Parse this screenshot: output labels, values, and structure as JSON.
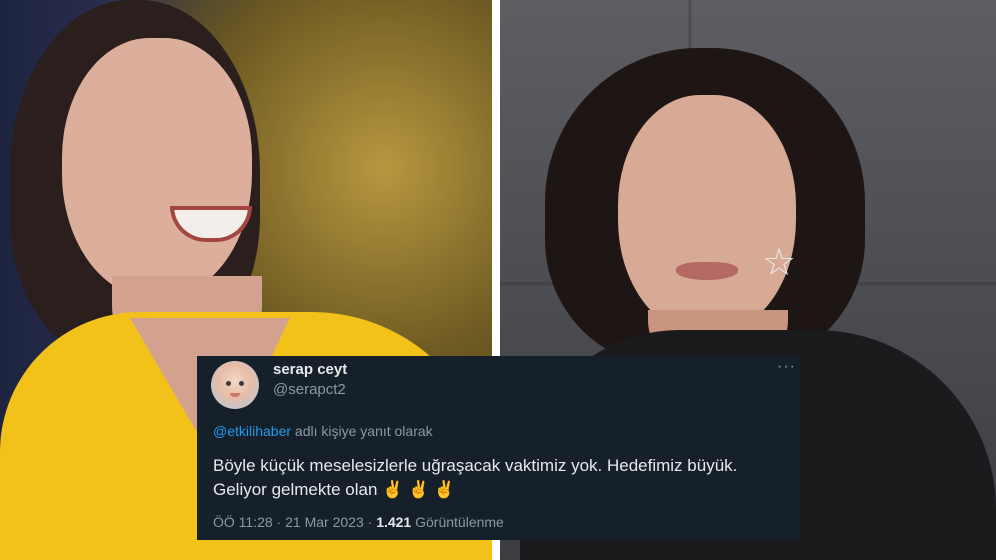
{
  "tweet": {
    "display_name": "serap ceyt",
    "handle": "@serapct2",
    "reply_mention": "@etkilihaber",
    "reply_suffix": " adlı kişiye yanıt olarak",
    "text_line_1": "Böyle küçük meselesizlerle uğraşacak vaktimiz yok. Hedefimiz büyük.",
    "text_line_2": "Geliyor gelmekte olan",
    "emojis": "✌️ ✌️ ✌️",
    "time": "ÖÖ 11:28",
    "separator": " · ",
    "date": "21 Mar 2023",
    "views_count": "1.421",
    "views_label": " Görüntülenme",
    "more_icon": "···"
  },
  "colors": {
    "card_background": "#15202b",
    "primary_text": "#e7e9ea",
    "secondary_text": "#8b98a5",
    "link": "#1d9bf0",
    "left_photo_jacket": "#f2c21b",
    "right_photo_top": "#1b1b1d"
  },
  "icons": {
    "avatar": "baby-photo-avatar",
    "more": "more-horizontal-icon"
  }
}
